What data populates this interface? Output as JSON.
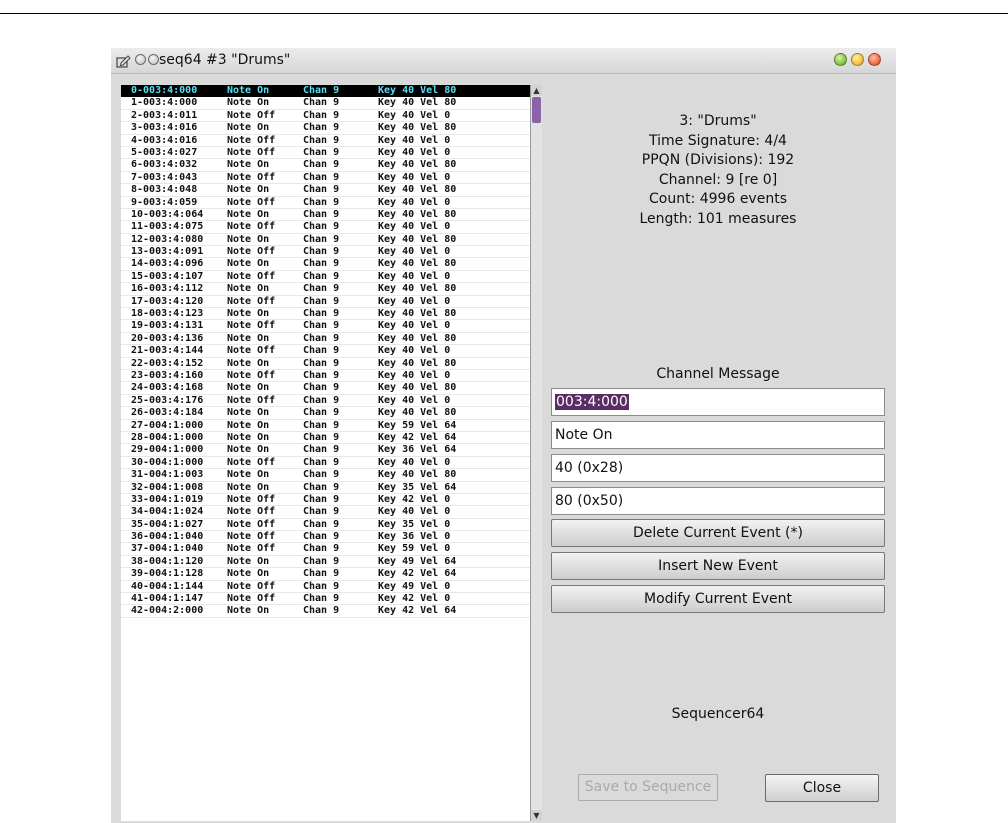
{
  "window": {
    "title": "seq64 #3 \"Drums\""
  },
  "events": [
    {
      "pos": "0-003:4:000",
      "type": "Note On",
      "chan": "Chan 9",
      "data": "Key 40 Vel 80"
    },
    {
      "pos": "1-003:4:000",
      "type": "Note On",
      "chan": "Chan 9",
      "data": "Key 40 Vel 80"
    },
    {
      "pos": "2-003:4:011",
      "type": "Note Off",
      "chan": "Chan 9",
      "data": "Key 40 Vel 0"
    },
    {
      "pos": "3-003:4:016",
      "type": "Note On",
      "chan": "Chan 9",
      "data": "Key 40 Vel 80"
    },
    {
      "pos": "4-003:4:016",
      "type": "Note Off",
      "chan": "Chan 9",
      "data": "Key 40 Vel 0"
    },
    {
      "pos": "5-003:4:027",
      "type": "Note Off",
      "chan": "Chan 9",
      "data": "Key 40 Vel 0"
    },
    {
      "pos": "6-003:4:032",
      "type": "Note On",
      "chan": "Chan 9",
      "data": "Key 40 Vel 80"
    },
    {
      "pos": "7-003:4:043",
      "type": "Note Off",
      "chan": "Chan 9",
      "data": "Key 40 Vel 0"
    },
    {
      "pos": "8-003:4:048",
      "type": "Note On",
      "chan": "Chan 9",
      "data": "Key 40 Vel 80"
    },
    {
      "pos": "9-003:4:059",
      "type": "Note Off",
      "chan": "Chan 9",
      "data": "Key 40 Vel 0"
    },
    {
      "pos": "10-003:4:064",
      "type": "Note On",
      "chan": "Chan 9",
      "data": "Key 40 Vel 80"
    },
    {
      "pos": "11-003:4:075",
      "type": "Note Off",
      "chan": "Chan 9",
      "data": "Key 40 Vel 0"
    },
    {
      "pos": "12-003:4:080",
      "type": "Note On",
      "chan": "Chan 9",
      "data": "Key 40 Vel 80"
    },
    {
      "pos": "13-003:4:091",
      "type": "Note Off",
      "chan": "Chan 9",
      "data": "Key 40 Vel 0"
    },
    {
      "pos": "14-003:4:096",
      "type": "Note On",
      "chan": "Chan 9",
      "data": "Key 40 Vel 80"
    },
    {
      "pos": "15-003:4:107",
      "type": "Note Off",
      "chan": "Chan 9",
      "data": "Key 40 Vel 0"
    },
    {
      "pos": "16-003:4:112",
      "type": "Note On",
      "chan": "Chan 9",
      "data": "Key 40 Vel 80"
    },
    {
      "pos": "17-003:4:120",
      "type": "Note Off",
      "chan": "Chan 9",
      "data": "Key 40 Vel 0"
    },
    {
      "pos": "18-003:4:123",
      "type": "Note On",
      "chan": "Chan 9",
      "data": "Key 40 Vel 80"
    },
    {
      "pos": "19-003:4:131",
      "type": "Note Off",
      "chan": "Chan 9",
      "data": "Key 40 Vel 0"
    },
    {
      "pos": "20-003:4:136",
      "type": "Note On",
      "chan": "Chan 9",
      "data": "Key 40 Vel 80"
    },
    {
      "pos": "21-003:4:144",
      "type": "Note Off",
      "chan": "Chan 9",
      "data": "Key 40 Vel 0"
    },
    {
      "pos": "22-003:4:152",
      "type": "Note On",
      "chan": "Chan 9",
      "data": "Key 40 Vel 80"
    },
    {
      "pos": "23-003:4:160",
      "type": "Note Off",
      "chan": "Chan 9",
      "data": "Key 40 Vel 0"
    },
    {
      "pos": "24-003:4:168",
      "type": "Note On",
      "chan": "Chan 9",
      "data": "Key 40 Vel 80"
    },
    {
      "pos": "25-003:4:176",
      "type": "Note Off",
      "chan": "Chan 9",
      "data": "Key 40 Vel 0"
    },
    {
      "pos": "26-003:4:184",
      "type": "Note On",
      "chan": "Chan 9",
      "data": "Key 40 Vel 80"
    },
    {
      "pos": "27-004:1:000",
      "type": "Note On",
      "chan": "Chan 9",
      "data": "Key 59 Vel 64"
    },
    {
      "pos": "28-004:1:000",
      "type": "Note On",
      "chan": "Chan 9",
      "data": "Key 42 Vel 64"
    },
    {
      "pos": "29-004:1:000",
      "type": "Note On",
      "chan": "Chan 9",
      "data": "Key 36 Vel 64"
    },
    {
      "pos": "30-004:1:000",
      "type": "Note Off",
      "chan": "Chan 9",
      "data": "Key 40 Vel 0"
    },
    {
      "pos": "31-004:1:003",
      "type": "Note On",
      "chan": "Chan 9",
      "data": "Key 40 Vel 80"
    },
    {
      "pos": "32-004:1:008",
      "type": "Note On",
      "chan": "Chan 9",
      "data": "Key 35 Vel 64"
    },
    {
      "pos": "33-004:1:019",
      "type": "Note Off",
      "chan": "Chan 9",
      "data": "Key 42 Vel 0"
    },
    {
      "pos": "34-004:1:024",
      "type": "Note Off",
      "chan": "Chan 9",
      "data": "Key 40 Vel 0"
    },
    {
      "pos": "35-004:1:027",
      "type": "Note Off",
      "chan": "Chan 9",
      "data": "Key 35 Vel 0"
    },
    {
      "pos": "36-004:1:040",
      "type": "Note Off",
      "chan": "Chan 9",
      "data": "Key 36 Vel 0"
    },
    {
      "pos": "37-004:1:040",
      "type": "Note Off",
      "chan": "Chan 9",
      "data": "Key 59 Vel 0"
    },
    {
      "pos": "38-004:1:120",
      "type": "Note On",
      "chan": "Chan 9",
      "data": "Key 49 Vel 64"
    },
    {
      "pos": "39-004:1:128",
      "type": "Note On",
      "chan": "Chan 9",
      "data": "Key 42 Vel 64"
    },
    {
      "pos": "40-004:1:144",
      "type": "Note Off",
      "chan": "Chan 9",
      "data": "Key 49 Vel 0"
    },
    {
      "pos": "41-004:1:147",
      "type": "Note Off",
      "chan": "Chan 9",
      "data": "Key 42 Vel 0"
    },
    {
      "pos": "42-004:2:000",
      "type": "Note On",
      "chan": "Chan 9",
      "data": "Key 42 Vel 64"
    }
  ],
  "selected_index": 0,
  "info": {
    "seq_name": "3: \"Drums\"",
    "time_signature": "Time Signature: 4/4",
    "ppqn": "PPQN (Divisions): 192",
    "channel": "Channel: 9 [re 0]",
    "count": "Count: 4996 events",
    "length": "Length: 101 measures"
  },
  "editor": {
    "section_title": "Channel Message",
    "timestamp_value": "003:4:000",
    "event_name_value": "Note On",
    "data_0_value": "40 (0x28)",
    "data_1_value": "80 (0x50)"
  },
  "buttons": {
    "delete": "Delete Current Event (*)",
    "insert": "Insert New Event",
    "modify": "Modify Current Event",
    "save": "Save to Sequence",
    "close": "Close"
  },
  "app_label": "Sequencer64",
  "colors": {
    "selection_bg": "#000000",
    "selection_text": "#58e0f0",
    "scroll_thumb": "#8a63a8",
    "text_selection": "#5b2d66"
  }
}
